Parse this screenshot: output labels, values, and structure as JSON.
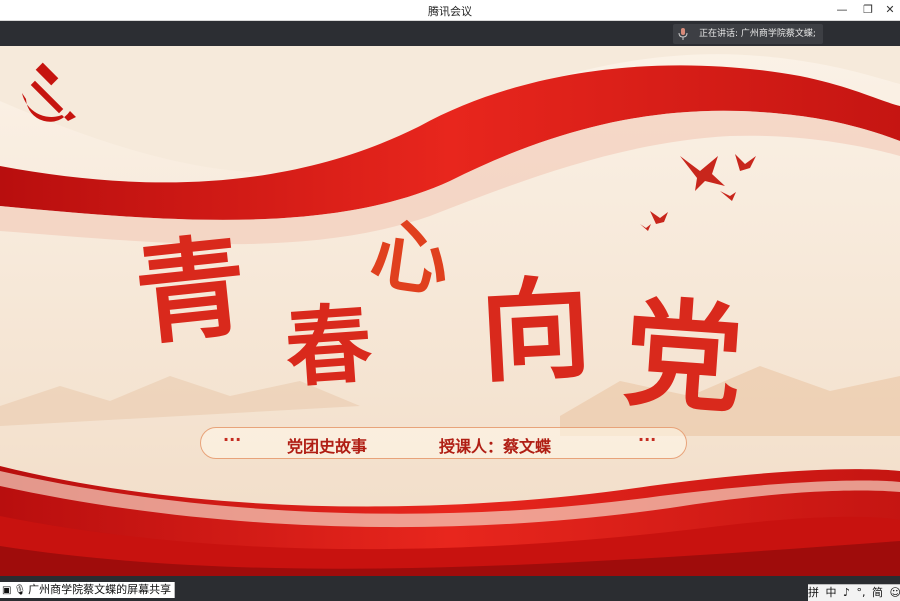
{
  "window": {
    "title": "腾讯会议",
    "minimize_glyph": "—",
    "restore_glyph": "❐",
    "close_glyph": "✕"
  },
  "speaker": {
    "label": "正在讲话: 广州商学院蔡文蝶;",
    "icon": "mic-icon"
  },
  "slide": {
    "title_chars": [
      "青",
      "春",
      "心",
      "向",
      "党"
    ],
    "subtitle_left_dots": "···",
    "subtitle_topic": "党团史故事",
    "subtitle_teacher": "授课人：蔡文蝶",
    "subtitle_right_dots": "···",
    "emblem": "hammer-sickle-icon",
    "decoration": "doves-icon"
  },
  "status": {
    "share_label": "广州商学院蔡文蝶的屏幕共享",
    "share_icons": "screen-icon mic-icon"
  },
  "ime": {
    "items": [
      "拼",
      "中",
      "♪",
      "°,",
      "简",
      "☺",
      "⋮"
    ]
  },
  "colors": {
    "ribbon_red": "#d71a16",
    "title_red": "#d9291c",
    "background": "#f6eadb"
  }
}
